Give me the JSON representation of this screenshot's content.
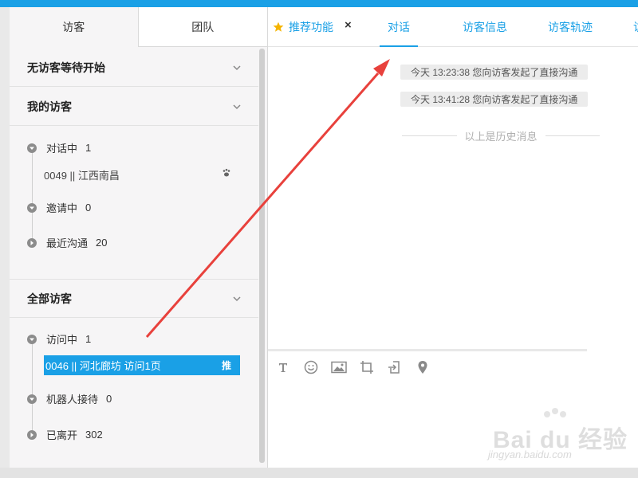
{
  "left": {
    "tabs": [
      {
        "label": "访客",
        "active": true
      },
      {
        "label": "团队",
        "active": false
      }
    ],
    "sections": {
      "waiting": {
        "title": "无访客等待开始"
      },
      "my_visitors": {
        "title": "我的访客",
        "chatting": {
          "label": "对话中",
          "count": "1"
        },
        "chatting_item": "0049 || 江西南昌",
        "inviting": {
          "label": "邀请中",
          "count": "0"
        },
        "recent": {
          "label": "最近沟通",
          "count": "20"
        }
      },
      "all_visitors": {
        "title": "全部访客",
        "visiting": {
          "label": "访问中",
          "count": "1"
        },
        "visiting_item": {
          "text": "0046 || 河北廊坊 访问1页",
          "tag": "推"
        },
        "robot": {
          "label": "机器人接待",
          "count": "0"
        },
        "left": {
          "label": "已离开",
          "count": "302"
        }
      }
    }
  },
  "right": {
    "tabs": [
      {
        "label": "推荐功能",
        "icon": "star-icon"
      },
      {
        "label": "对话",
        "active": true
      },
      {
        "label": "访客信息"
      },
      {
        "label": "访客轨迹"
      },
      {
        "label": "访"
      }
    ],
    "close_symbol": "×",
    "messages": [
      "今天 13:23:38 您向访客发起了直接沟通",
      "今天 13:41:28 您向访客发起了直接沟通"
    ],
    "history_divider": "以上是历史消息",
    "toolbar": [
      "text-format-icon",
      "emoji-icon",
      "image-icon",
      "crop-icon",
      "file-transfer-icon",
      "location-icon"
    ]
  },
  "watermark": {
    "text": "Bai du 经验",
    "sub": "jingyan.baidu.com"
  },
  "colors": {
    "accent": "#1aa0e6",
    "arrow": "#e8413c",
    "panel_bg": "#f6f5f6"
  }
}
